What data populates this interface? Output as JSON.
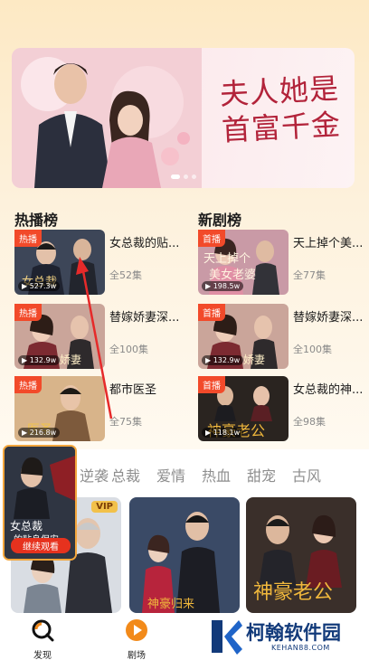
{
  "banner": {
    "title": "夫人她是首富千金",
    "title_line1": "夫人她是",
    "title_line2": "首富千金"
  },
  "hot_rank": {
    "title": "热播榜",
    "items": [
      {
        "tag": "热播",
        "plays": "527.3w",
        "title": "女总裁的贴...",
        "eps": "全52集"
      },
      {
        "tag": "热播",
        "plays": "132.9w",
        "title": "替嫁娇妻深...",
        "eps": "全100集"
      },
      {
        "tag": "热播",
        "plays": "216.8w",
        "title": "都市医圣",
        "eps": "全75集"
      }
    ]
  },
  "new_rank": {
    "title": "新剧榜",
    "items": [
      {
        "tag": "首播",
        "plays": "198.5w",
        "title": "天上掉个美...",
        "eps": "全77集"
      },
      {
        "tag": "首播",
        "plays": "132.9w",
        "title": "替嫁娇妻深...",
        "eps": "全100集"
      },
      {
        "tag": "首播",
        "plays": "118.1w",
        "title": "女总裁的神...",
        "eps": "全98集"
      }
    ]
  },
  "categories": [
    "逆袭",
    "总裁",
    "爱情",
    "热血",
    "甜宠",
    "古风"
  ],
  "grid": [
    {
      "badge": "VIP"
    },
    {
      "badge": ""
    },
    {
      "badge": ""
    }
  ],
  "float_player": {
    "button": "继续观看"
  },
  "nav": {
    "discover": "发现",
    "theater": "剧场"
  },
  "watermark": {
    "name": "柯翰软件园",
    "url": "KEHAN88.COM"
  },
  "colors": {
    "accent": "#f24a2a",
    "nav_active": "#f28a1a",
    "background_top": "#fde9c4"
  }
}
